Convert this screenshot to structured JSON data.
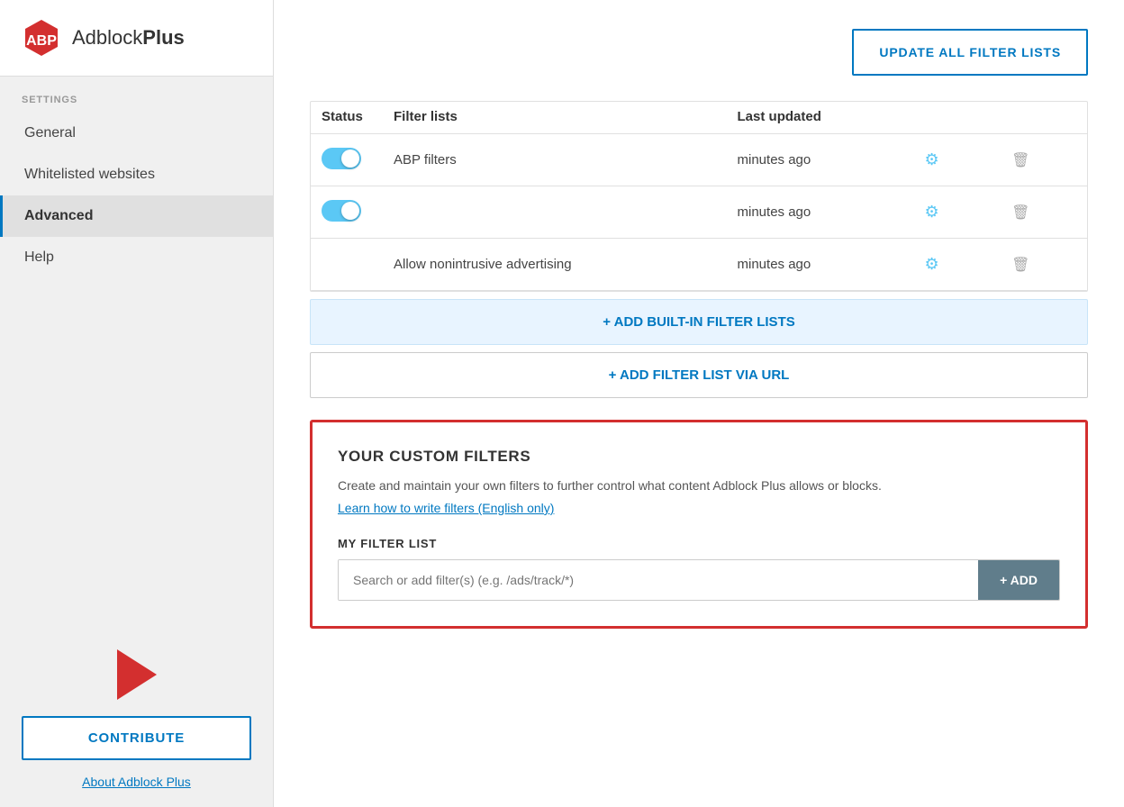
{
  "app": {
    "name_part1": "Adblock",
    "name_part2": "Plus"
  },
  "sidebar": {
    "settings_label": "SETTINGS",
    "nav_items": [
      {
        "id": "general",
        "label": "General",
        "active": false
      },
      {
        "id": "whitelisted",
        "label": "Whitelisted websites",
        "active": false
      },
      {
        "id": "advanced",
        "label": "Advanced",
        "active": true
      },
      {
        "id": "help",
        "label": "Help",
        "active": false
      }
    ],
    "contribute_label": "CONTRIBUTE",
    "about_label": "About Adblock Plus"
  },
  "main": {
    "update_all_label": "UPDATE ALL FILTER LISTS",
    "table": {
      "headers": [
        "Status",
        "Filter lists",
        "Last updated",
        "",
        ""
      ],
      "rows": [
        {
          "toggle": true,
          "name": "ABP filters",
          "last_updated": "minutes ago"
        },
        {
          "toggle": true,
          "name": "",
          "last_updated": "minutes ago"
        },
        {
          "toggle": null,
          "name": "Allow nonintrusive advertising",
          "last_updated": "minutes ago"
        }
      ]
    },
    "add_builtin_label": "+ ADD BUILT-IN FILTER LISTS",
    "add_url_label": "+ ADD FILTER LIST VIA URL",
    "custom_filters": {
      "title": "YOUR CUSTOM FILTERS",
      "description": "Create and maintain your own filters to further control what content Adblock Plus allows or blocks.",
      "learn_link": "Learn how to write filters (English only)",
      "my_filter_list_label": "MY FILTER LIST",
      "search_placeholder": "Search or add filter(s) (e.g. /ads/track/*)",
      "add_btn_label": "+ ADD"
    }
  }
}
